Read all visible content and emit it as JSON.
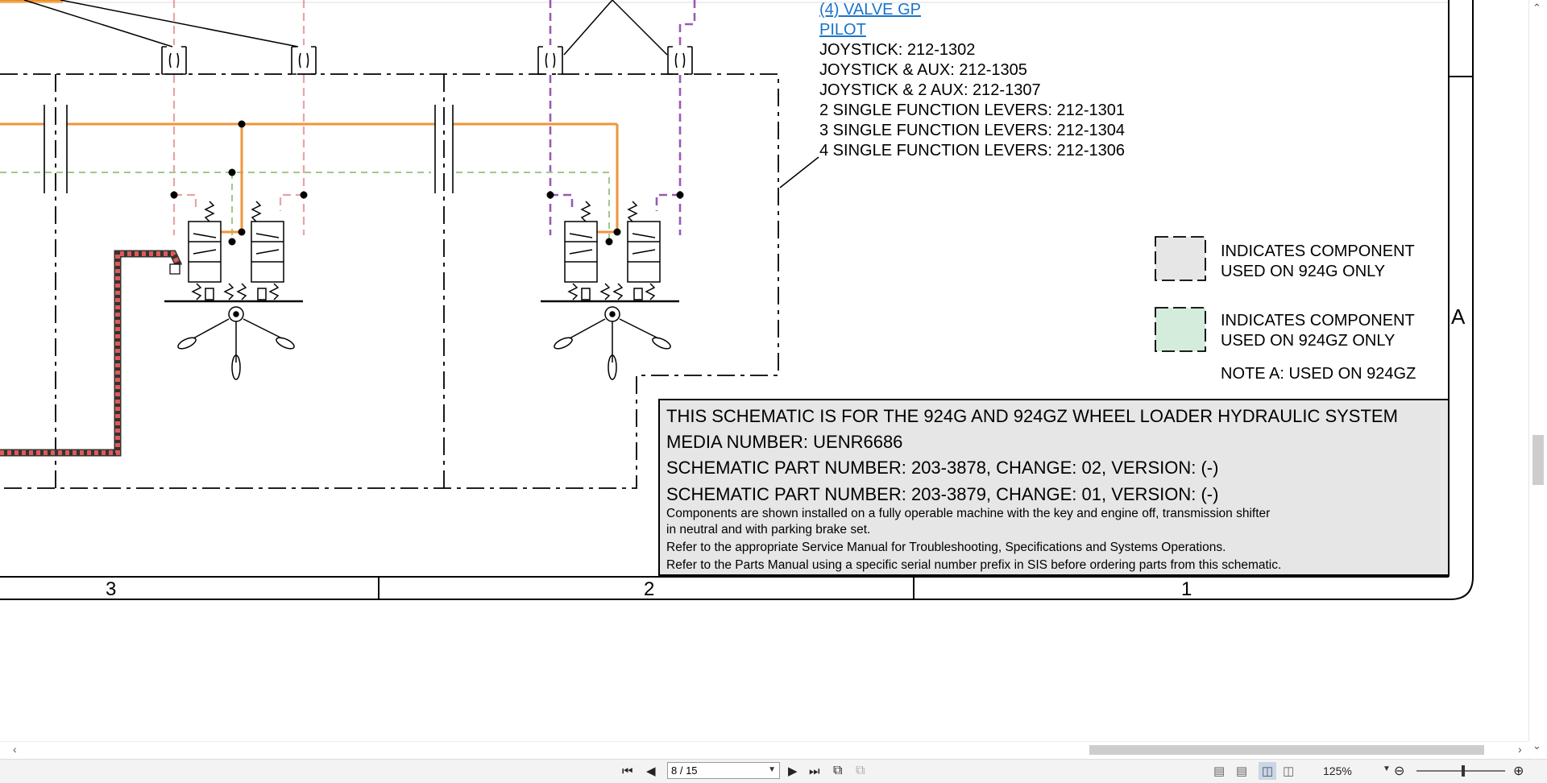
{
  "viewer": {
    "page_indicator": "8 / 15",
    "zoom_label": "125%",
    "zoom_percent": 125
  },
  "drawing": {
    "link_line1": "(4) VALVE GP",
    "link_line2": "PILOT",
    "part_list": [
      "JOYSTICK: 212-1302",
      "JOYSTICK & AUX: 212-1305",
      "JOYSTICK & 2 AUX: 212-1307",
      "2 SINGLE FUNCTION LEVERS: 212-1301",
      "3 SINGLE FUNCTION LEVERS: 212-1304",
      "4 SINGLE FUNCTION LEVERS: 212-1306"
    ],
    "legend": {
      "gray_line1": "INDICATES COMPONENT",
      "gray_line2": "USED ON 924G ONLY",
      "green_line1": "INDICATES COMPONENT",
      "green_line2": "USED ON 924GZ ONLY",
      "note": "NOTE A: USED ON 924GZ",
      "gray_color": "#e6e6e6",
      "green_color": "#d4ecdc"
    },
    "zone_letter": "A",
    "info": {
      "line1": "THIS SCHEMATIC IS FOR THE 924G AND 924GZ WHEEL LOADER HYDRAULIC SYSTEM",
      "line2": "MEDIA NUMBER: UENR6686",
      "line3": "SCHEMATIC PART NUMBER: 203-3878, CHANGE: 02, VERSION: (-)",
      "line4": "SCHEMATIC PART NUMBER: 203-3879, CHANGE: 01, VERSION: (-)",
      "small1": "Components are shown installed on a fully operable machine with the key and engine off, transmission shifter",
      "small2": "in neutral and with parking brake set.",
      "small3": "Refer to the appropriate Service Manual for Troubleshooting, Specifications and Systems Operations.",
      "small4": "Refer to the Parts Manual using a specific serial number prefix in SIS before ordering parts from this schematic."
    },
    "zone_numbers": [
      "3",
      "2",
      "1"
    ],
    "colors": {
      "orange": "#ef9539",
      "pink": "#e8a3a6",
      "green": "#9ec98a",
      "purple": "#9b59b6",
      "link": "#1a73c9",
      "red_hose": "#e05a55"
    }
  }
}
